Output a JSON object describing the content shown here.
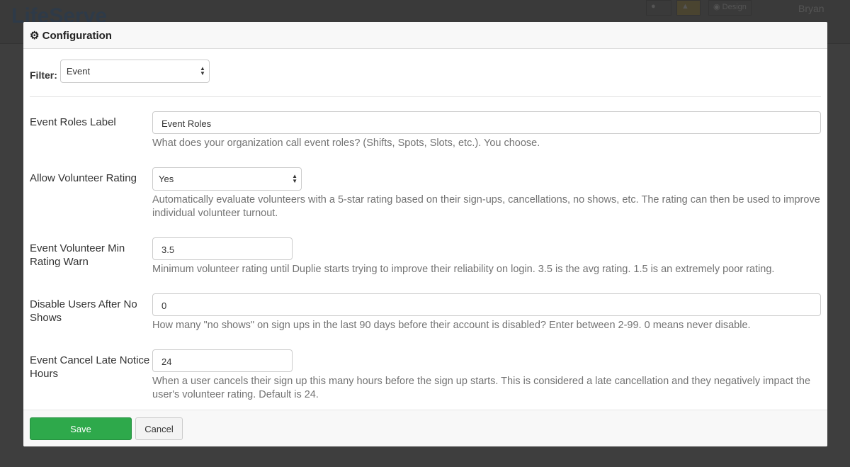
{
  "background": {
    "logo": "LifeServe",
    "design_label": "Design",
    "user": "Bryan"
  },
  "modal": {
    "title": "Configuration",
    "filter": {
      "label": "Filter:",
      "value": "Event"
    },
    "fields": [
      {
        "label": "Event Roles Label",
        "type": "text",
        "value": "Event Roles",
        "help": "What does your organization call event roles? (Shifts, Spots, Slots, etc.). You choose."
      },
      {
        "label": "Allow Volunteer Rating",
        "type": "select",
        "value": "Yes",
        "help": "Automatically evaluate volunteers with a 5-star rating based on their sign-ups, cancellations, no shows, etc. The rating can then be used to improve individual volunteer turnout."
      },
      {
        "label": "Event Volunteer Min Rating Warn",
        "type": "text",
        "value": "3.5",
        "help": "Minimum volunteer rating until Duplie starts trying to improve their reliability on login. 3.5 is the avg rating. 1.5 is an extremely poor rating."
      },
      {
        "label": "Disable Users After No Shows",
        "type": "text",
        "value": "0",
        "help": "How many \"no shows\" on sign ups in the last 90 days before their account is disabled? Enter between 2-99. 0 means never disable."
      },
      {
        "label": "Event Cancel Late Notice Hours",
        "type": "text",
        "value": "24",
        "help": "When a user cancels their sign up this many hours before the sign up starts. This is considered a late cancellation and they negatively impact the user's volunteer rating. Default is 24."
      }
    ],
    "save_label": "Save",
    "cancel_label": "Cancel"
  }
}
